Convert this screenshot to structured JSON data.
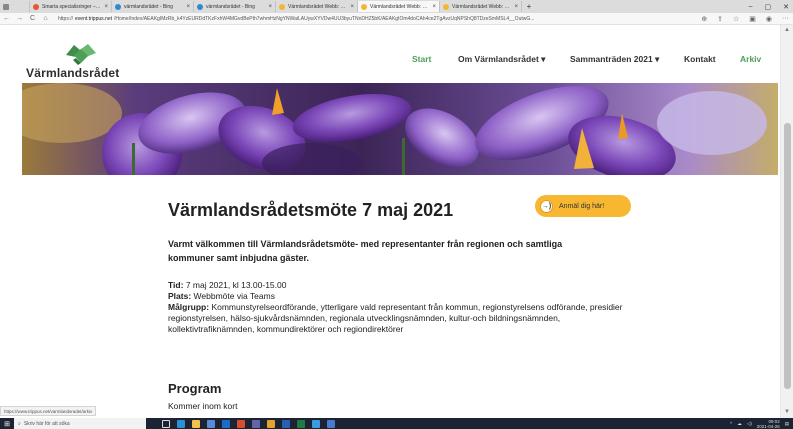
{
  "browser": {
    "tabs": [
      {
        "label": "Smarta specialisringer – omdö",
        "color": "#e8552f"
      },
      {
        "label": "värmlandsrådet - Bing",
        "color": "#2a8bd1"
      },
      {
        "label": "värmlandsrådet - Bing",
        "color": "#2a8bd1"
      },
      {
        "label": "Värmlandsrådet Webb: Start",
        "color": "#f2b632"
      },
      {
        "label": "Värmlandsrådet Webb: Start",
        "color": "#f2b632"
      },
      {
        "label": "Värmlandsrådet Webb: Start anr",
        "color": "#f2b632"
      }
    ],
    "new_tab": "+",
    "window_controls": {
      "minimize": "–",
      "maximize": "▢",
      "close": "✕"
    },
    "nav": {
      "back": "←",
      "forward": "→",
      "reload": "C",
      "home": "⌂"
    },
    "url_prefix": "https://",
    "url_host": "event.trippus.net",
    "url_path": "/Home/Index/AEAKgIMzRb_k4YzEURDdTKzFxhW4MGvdBePth7whmHzNgYNWaiLAUywXYVDw4UU3byuTNnDHZ5bK/AEAKgIOm4doCAh4ce2TgAvzUqNPShQ8TDzeSmMSL4__OutwG...",
    "tool_icons": [
      "zoom-icon",
      "share-icon",
      "favorites-icon",
      "collections-icon",
      "profile-icon",
      "more-icon"
    ]
  },
  "site": {
    "logo_text": "Värmlandsrådet",
    "nav": {
      "start": "Start",
      "om": "Om Värmlandsrådet ▾",
      "sammantraden": "Sammanträden 2021 ▾",
      "kontakt": "Kontakt",
      "arkiv": "Arkiv"
    },
    "brand_color": "#4e9e58"
  },
  "event": {
    "title": "Värmlandsrådetsmöte 7 maj 2021",
    "register_icon": "→)",
    "register_label": "Anmäl dig här!",
    "lead": "Varmt välkommen till Värmlandsrådetsmöte- med representanter från regionen och samtliga kommuner samt inbjudna gäster.",
    "tid_label": "Tid:",
    "tid_value": "7 maj 2021, kl 13.00-15.00",
    "plats_label": "Plats:",
    "plats_value": "Webbmöte via Teams",
    "malgrupp_label": "Målgrupp:",
    "malgrupp_value": "Kommunstyrelseordförande, ytterligare vald representant från kommun, regionstyrelsens odförande, presidier regionstyrelsen, hälso-sjukvårdsnämnden, regionala utvecklingsnämnden, kultur-och bildningsnämnden,  kollektivtrafiknämnden, kommundirektörer och regiondirektörer",
    "program_heading": "Program",
    "program_text": "Kommer inom kort"
  },
  "status_url": "https://www.trippus.net/varmlandsradet/arkiv",
  "taskbar": {
    "search_placeholder": "Skriv här för att söka",
    "clock_time": "09:02",
    "clock_date": "2021-04-26"
  }
}
